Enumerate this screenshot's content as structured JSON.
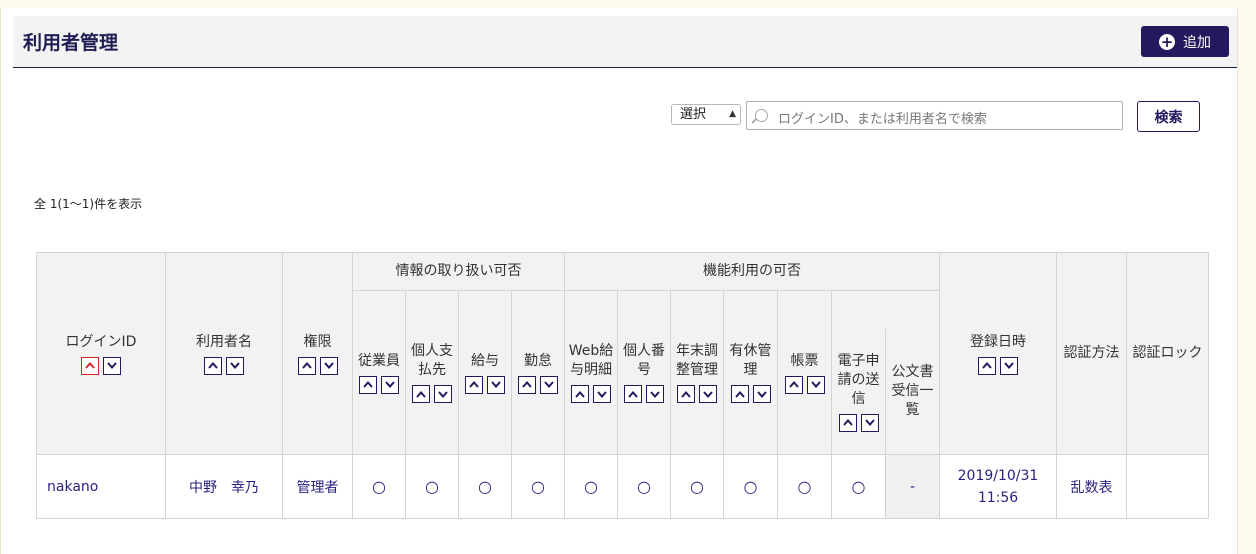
{
  "header": {
    "title": "利用者管理",
    "add_label": "追加"
  },
  "search": {
    "select_value": "選択",
    "placeholder": "ログインID、または利用者名で検索",
    "button_label": "検索"
  },
  "result_count": "全 1(1〜1)件を表示",
  "table": {
    "groups": {
      "info": "情報の取り扱い可否",
      "feature": "機能利用の可否"
    },
    "columns": {
      "login_id": "ログインID",
      "name": "利用者名",
      "role": "権限",
      "employee": "従業員",
      "personal_dest": "個人支払先",
      "salary": "給与",
      "attendance": "勤怠",
      "web_payslip": "Web給与明細",
      "personal_number": "個人番号",
      "year_end": "年末調整管理",
      "paid_leave": "有休管理",
      "ledger": "帳票",
      "e_filing": "電子申請の送信",
      "official_doc": "公文書受信一覧",
      "registered_at": "登録日時",
      "auth_method": "認証方法",
      "auth_lock": "認証ロック"
    },
    "rows": [
      {
        "login_id": "nakano",
        "name": "中野　幸乃",
        "role": "管理者",
        "employee": "○",
        "personal_dest": "○",
        "salary": "○",
        "attendance": "○",
        "web_payslip": "○",
        "personal_number": "○",
        "year_end": "○",
        "paid_leave": "○",
        "ledger": "○",
        "e_filing": "○",
        "official_doc": "-",
        "registered_at": "2019/10/31 11:56",
        "auth_method": "乱数表",
        "auth_lock": ""
      }
    ]
  },
  "icons": {
    "add": "plus-circle-icon",
    "search": "search-icon",
    "sort_asc": "chevron-up-icon",
    "sort_desc": "chevron-down-icon"
  },
  "colors": {
    "brand": "#22195e",
    "link": "#2a2480",
    "active_sort": "#d42a2a",
    "background": "#fdf9ee"
  }
}
